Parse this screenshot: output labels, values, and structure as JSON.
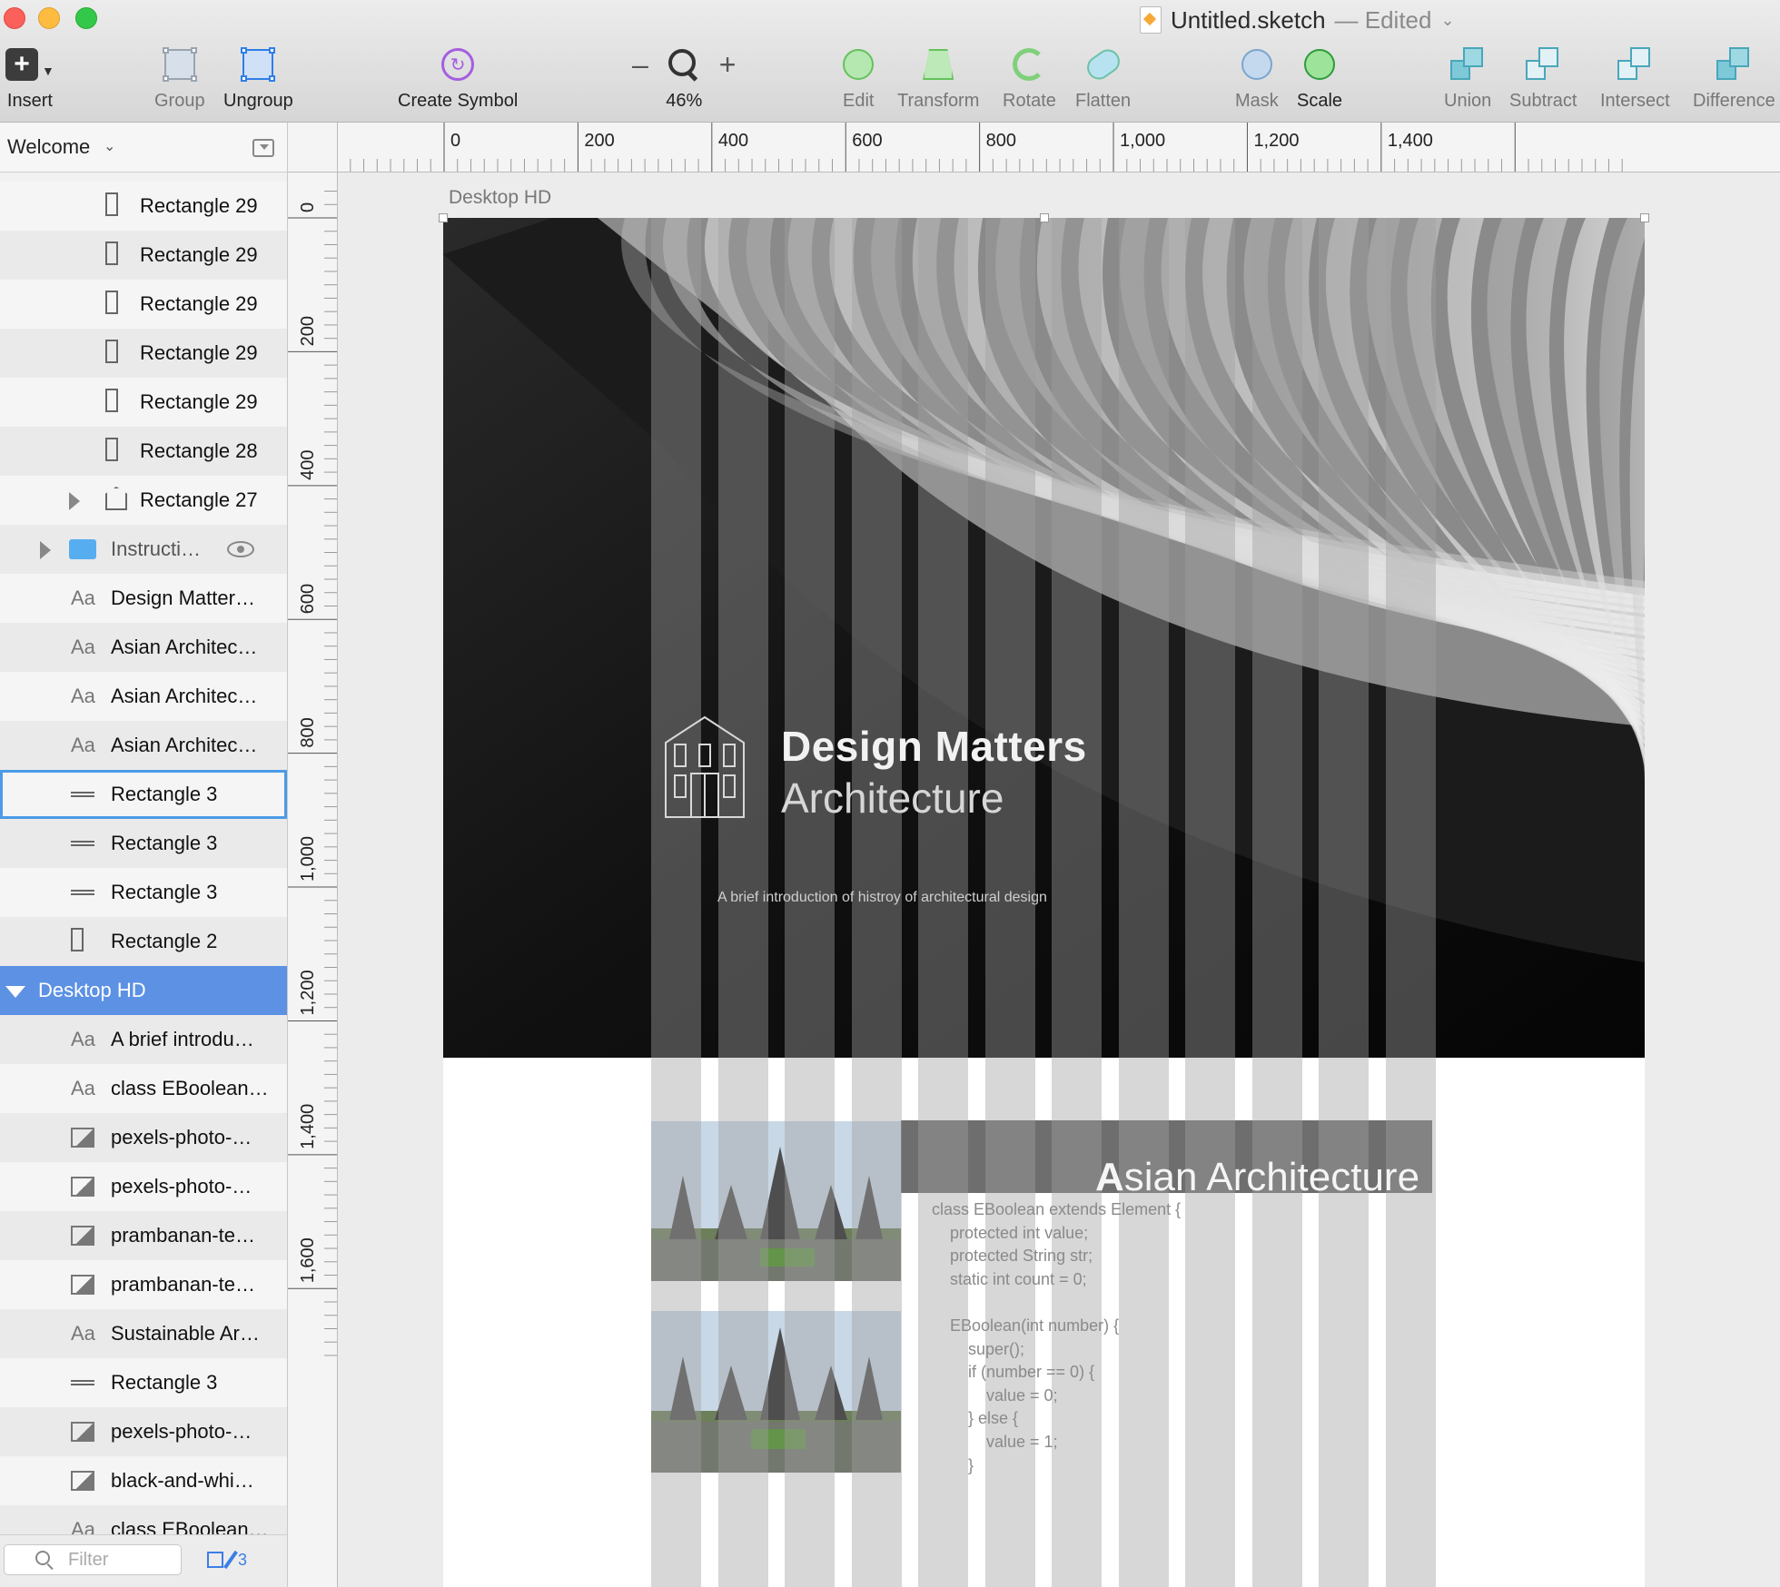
{
  "window": {
    "file_name": "Untitled.sketch",
    "edited_label": "— Edited"
  },
  "toolbar": {
    "insert": "Insert",
    "group": "Group",
    "ungroup": "Ungroup",
    "create_symbol": "Create Symbol",
    "zoom_minus": "–",
    "zoom_plus": "+",
    "zoom_level": "46%",
    "edit": "Edit",
    "transform": "Transform",
    "rotate": "Rotate",
    "flatten": "Flatten",
    "mask": "Mask",
    "scale": "Scale",
    "union": "Union",
    "subtract": "Subtract",
    "intersect": "Intersect",
    "difference": "Difference"
  },
  "sidebar": {
    "page_name": "Welcome",
    "layers": [
      {
        "name": "Rectangle 29",
        "icon": "rectangle-icon",
        "indent": 2
      },
      {
        "name": "Rectangle 29",
        "icon": "rectangle-icon",
        "indent": 2
      },
      {
        "name": "Rectangle 29",
        "icon": "rectangle-icon",
        "indent": 2
      },
      {
        "name": "Rectangle 29",
        "icon": "rectangle-icon",
        "indent": 2
      },
      {
        "name": "Rectangle 29",
        "icon": "rectangle-icon",
        "indent": 2
      },
      {
        "name": "Rectangle 28",
        "icon": "rectangle-icon",
        "indent": 2
      },
      {
        "name": "Rectangle 27",
        "icon": "shape-icon",
        "indent": 2,
        "disclosure": "closed"
      },
      {
        "name": "Instructi…",
        "icon": "folder-icon",
        "indent": 1,
        "disclosure": "closed",
        "visibility": true
      },
      {
        "name": "Design Matter…",
        "icon": "text-icon",
        "indent": 1
      },
      {
        "name": "Asian Architec…",
        "icon": "text-icon",
        "indent": 1
      },
      {
        "name": "Asian Architec…",
        "icon": "text-icon",
        "indent": 1
      },
      {
        "name": "Asian Architec…",
        "icon": "text-icon",
        "indent": 1
      },
      {
        "name": "Rectangle 3",
        "icon": "line-icon",
        "indent": 1,
        "hover": true
      },
      {
        "name": "Rectangle 3",
        "icon": "line-icon",
        "indent": 1
      },
      {
        "name": "Rectangle 3",
        "icon": "line-icon",
        "indent": 1
      },
      {
        "name": "Rectangle 2",
        "icon": "rectangle-icon",
        "indent": 1
      },
      {
        "name": "Desktop HD",
        "icon": "artboard",
        "indent": 0,
        "disclosure": "open",
        "selected": true
      },
      {
        "name": "A brief introdu…",
        "icon": "text-icon",
        "indent": 1
      },
      {
        "name": "class EBoolean…",
        "icon": "text-icon",
        "indent": 1
      },
      {
        "name": "pexels-photo-…",
        "icon": "image-icon",
        "indent": 1
      },
      {
        "name": "pexels-photo-…",
        "icon": "image-icon",
        "indent": 1
      },
      {
        "name": "prambanan-te…",
        "icon": "image-icon",
        "indent": 1
      },
      {
        "name": "prambanan-te…",
        "icon": "image-icon",
        "indent": 1
      },
      {
        "name": "Sustainable Ar…",
        "icon": "text-icon",
        "indent": 1
      },
      {
        "name": "Rectangle 3",
        "icon": "line-icon",
        "indent": 1
      },
      {
        "name": "pexels-photo-…",
        "icon": "image-icon",
        "indent": 1
      },
      {
        "name": "black-and-whi…",
        "icon": "image-icon",
        "indent": 1
      },
      {
        "name": "class EBoolean…",
        "icon": "text-icon",
        "indent": 1
      }
    ],
    "filter_placeholder": "Filter",
    "page_count": "3"
  },
  "rulers": {
    "horizontal": [
      "0",
      "200",
      "400",
      "600",
      "800",
      "1,000",
      "1,200",
      "1,400"
    ],
    "vertical": [
      "0",
      "200",
      "400",
      "600",
      "800",
      "1,000",
      "1,200",
      "1,400",
      "1,600"
    ]
  },
  "artboard": {
    "name": "Desktop HD",
    "hero_title": "Design Matters",
    "hero_subtitle": "Architecture",
    "hero_description": "A brief introduction of histroy of architectural design",
    "section_title_first": "A",
    "section_title_rest": "sian Architecture",
    "code_lines": [
      "class EBoolean extends Element {",
      "    protected int value;",
      "    protected String str;",
      "    static int count = 0;",
      "",
      "    EBoolean(int number) {",
      "        super();",
      "        if (number == 0) {",
      "            value = 0;",
      "        } else {",
      "            value = 1;",
      "        }"
    ]
  }
}
